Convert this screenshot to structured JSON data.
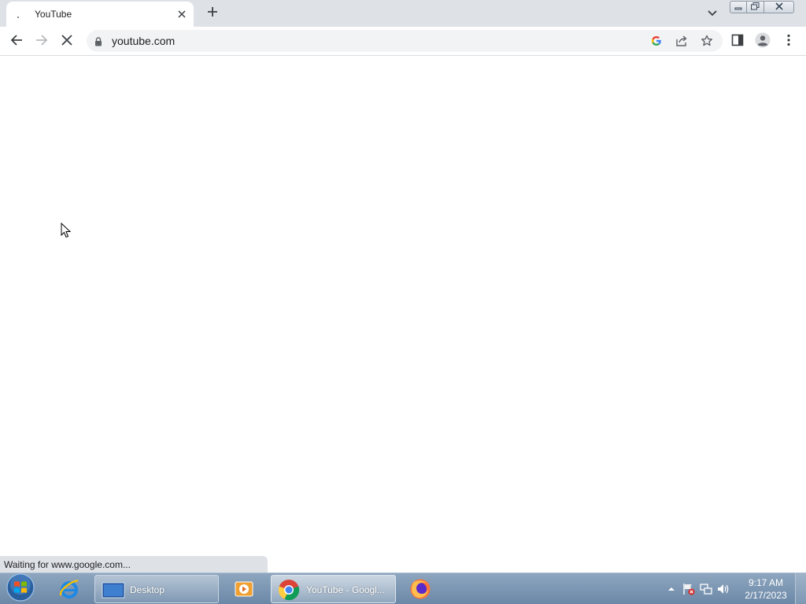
{
  "browser": {
    "tab": {
      "title": "YouTube"
    },
    "omnibox": {
      "url": "youtube.com"
    },
    "status_text": "Waiting for www.google.com..."
  },
  "taskbar": {
    "items": [
      {
        "label": "Desktop"
      },
      {
        "label": "YouTube - Googl..."
      }
    ],
    "clock": {
      "time": "9:17 AM",
      "date": "2/17/2023"
    }
  },
  "icons": {
    "tab": [
      "loading-favicon-icon",
      "close-icon",
      "plus-icon",
      "chevron-down-icon"
    ],
    "window": [
      "minimize-icon",
      "restore-icon",
      "close-icon"
    ],
    "toolbar": [
      "back-arrow-icon",
      "forward-arrow-icon",
      "stop-loading-icon",
      "lock-icon",
      "google-icon",
      "share-icon",
      "star-icon",
      "side-panel-icon",
      "profile-icon",
      "kebab-menu-icon"
    ],
    "taskbar": [
      "windows-start-icon",
      "internet-explorer-icon",
      "desktop-icon",
      "media-player-icon",
      "chrome-icon",
      "firefox-icon"
    ],
    "tray": [
      "show-hidden-icons-chevron-icon",
      "action-center-flag-icon",
      "network-icon",
      "volume-icon"
    ]
  },
  "colors": {
    "tabstrip": "#dee1e6",
    "omnibox": "#f1f3f4",
    "taskbar": "#7b95b1",
    "google_blue": "#4285f4",
    "google_red": "#ea4335",
    "google_yellow": "#fbbc05",
    "google_green": "#34a853"
  }
}
